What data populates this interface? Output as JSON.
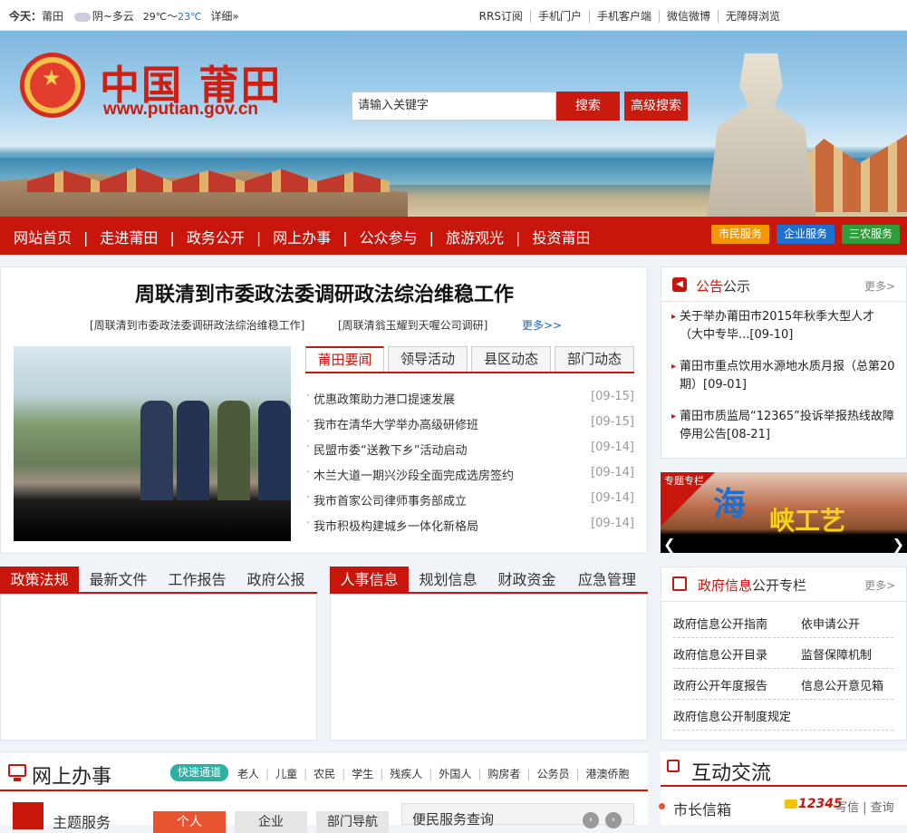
{
  "topbar": {
    "today_label": "今天：",
    "city": "莆田",
    "weather": "阴~多云",
    "temp_high": "29℃",
    "temp_sep": "～",
    "temp_low": "23℃",
    "detail": "详细»",
    "links": [
      "RRS订阅",
      "手机门户",
      "手机客户端",
      "微信微博",
      "无障碍浏览"
    ]
  },
  "header": {
    "title": "中国 莆田",
    "url": "www.putian.gov.cn",
    "search_placeholder": "请输入关键字",
    "search_button": "搜索",
    "advanced_search": "高级搜索"
  },
  "nav": {
    "items": [
      "网站首页",
      "走进莆田",
      "政务公开",
      "网上办事",
      "公众参与",
      "旅游观光",
      "投资莆田"
    ],
    "separator": "|",
    "services": [
      {
        "label": "市民服务",
        "color": "#f39800"
      },
      {
        "label": "企业服务",
        "color": "#1d6fd0"
      },
      {
        "label": "三农服务",
        "color": "#2f9d3a"
      }
    ]
  },
  "headline": {
    "title": "周联清到市委政法委调研政法综治维稳工作",
    "sub1": "[周联清到市委政法委调研政法综治维稳工作]",
    "sub2": "[周联清翁玉耀到天喔公司调研]",
    "more": "更多>>"
  },
  "news_tabs": [
    "莆田要闻",
    "领导活动",
    "县区动态",
    "部门动态"
  ],
  "news": [
    {
      "title": "优惠政策助力港口提速发展",
      "date": "[09-15]"
    },
    {
      "title": "我市在清华大学举办高级研修班",
      "date": "[09-15]"
    },
    {
      "title": "民盟市委“送教下乡”活动启动",
      "date": "[09-14]"
    },
    {
      "title": "木兰大道一期兴沙段全面完成选房签约",
      "date": "[09-14]"
    },
    {
      "title": "我市首家公司律师事务部成立",
      "date": "[09-14]"
    },
    {
      "title": "我市积极构建城乡一体化新格局",
      "date": "[09-14]"
    }
  ],
  "notice": {
    "title_red": "公告",
    "title_rest": "公示",
    "more": "更多>",
    "items": [
      "关于举办莆田市2015年秋季大型人才（大中专毕...[09-10]",
      "莆田市重点饮用水源地水质月报（总第20期）[09-01]",
      "莆田市质监局“12365”投诉举报热线故障停用公告[08-21]"
    ]
  },
  "special": {
    "tag": "专题专栏",
    "hai": "海",
    "text": "峡工艺"
  },
  "policy_tabs": [
    "政策法规",
    "最新文件",
    "工作报告",
    "政府公报"
  ],
  "hr_tabs": [
    "人事信息",
    "规划信息",
    "财政资金",
    "应急管理"
  ],
  "govinfo": {
    "title_red": "政府信息",
    "title_rest": "公开专栏",
    "more": "更多>",
    "links": [
      [
        "政府信息公开指南",
        "依申请公开"
      ],
      [
        "政府信息公开目录",
        "监督保障机制"
      ],
      [
        "政府公开年度报告",
        "信息公开意见箱"
      ],
      [
        "政府信息公开制度规定",
        ""
      ]
    ]
  },
  "online": {
    "title": "网上办事",
    "quick": "快速通道",
    "categories": [
      "老人",
      "儿童",
      "农民",
      "学生",
      "残疾人",
      "外国人",
      "购房者",
      "公务员",
      "港澳侨胞"
    ],
    "theme": "主题服务",
    "btns": [
      "个人",
      "企业",
      "部门导航"
    ],
    "convenience": "便民服务查询"
  },
  "interact": {
    "title": "互动交流",
    "item": "市长信箱",
    "hotline": "12345",
    "links": "写信 | 查询"
  }
}
